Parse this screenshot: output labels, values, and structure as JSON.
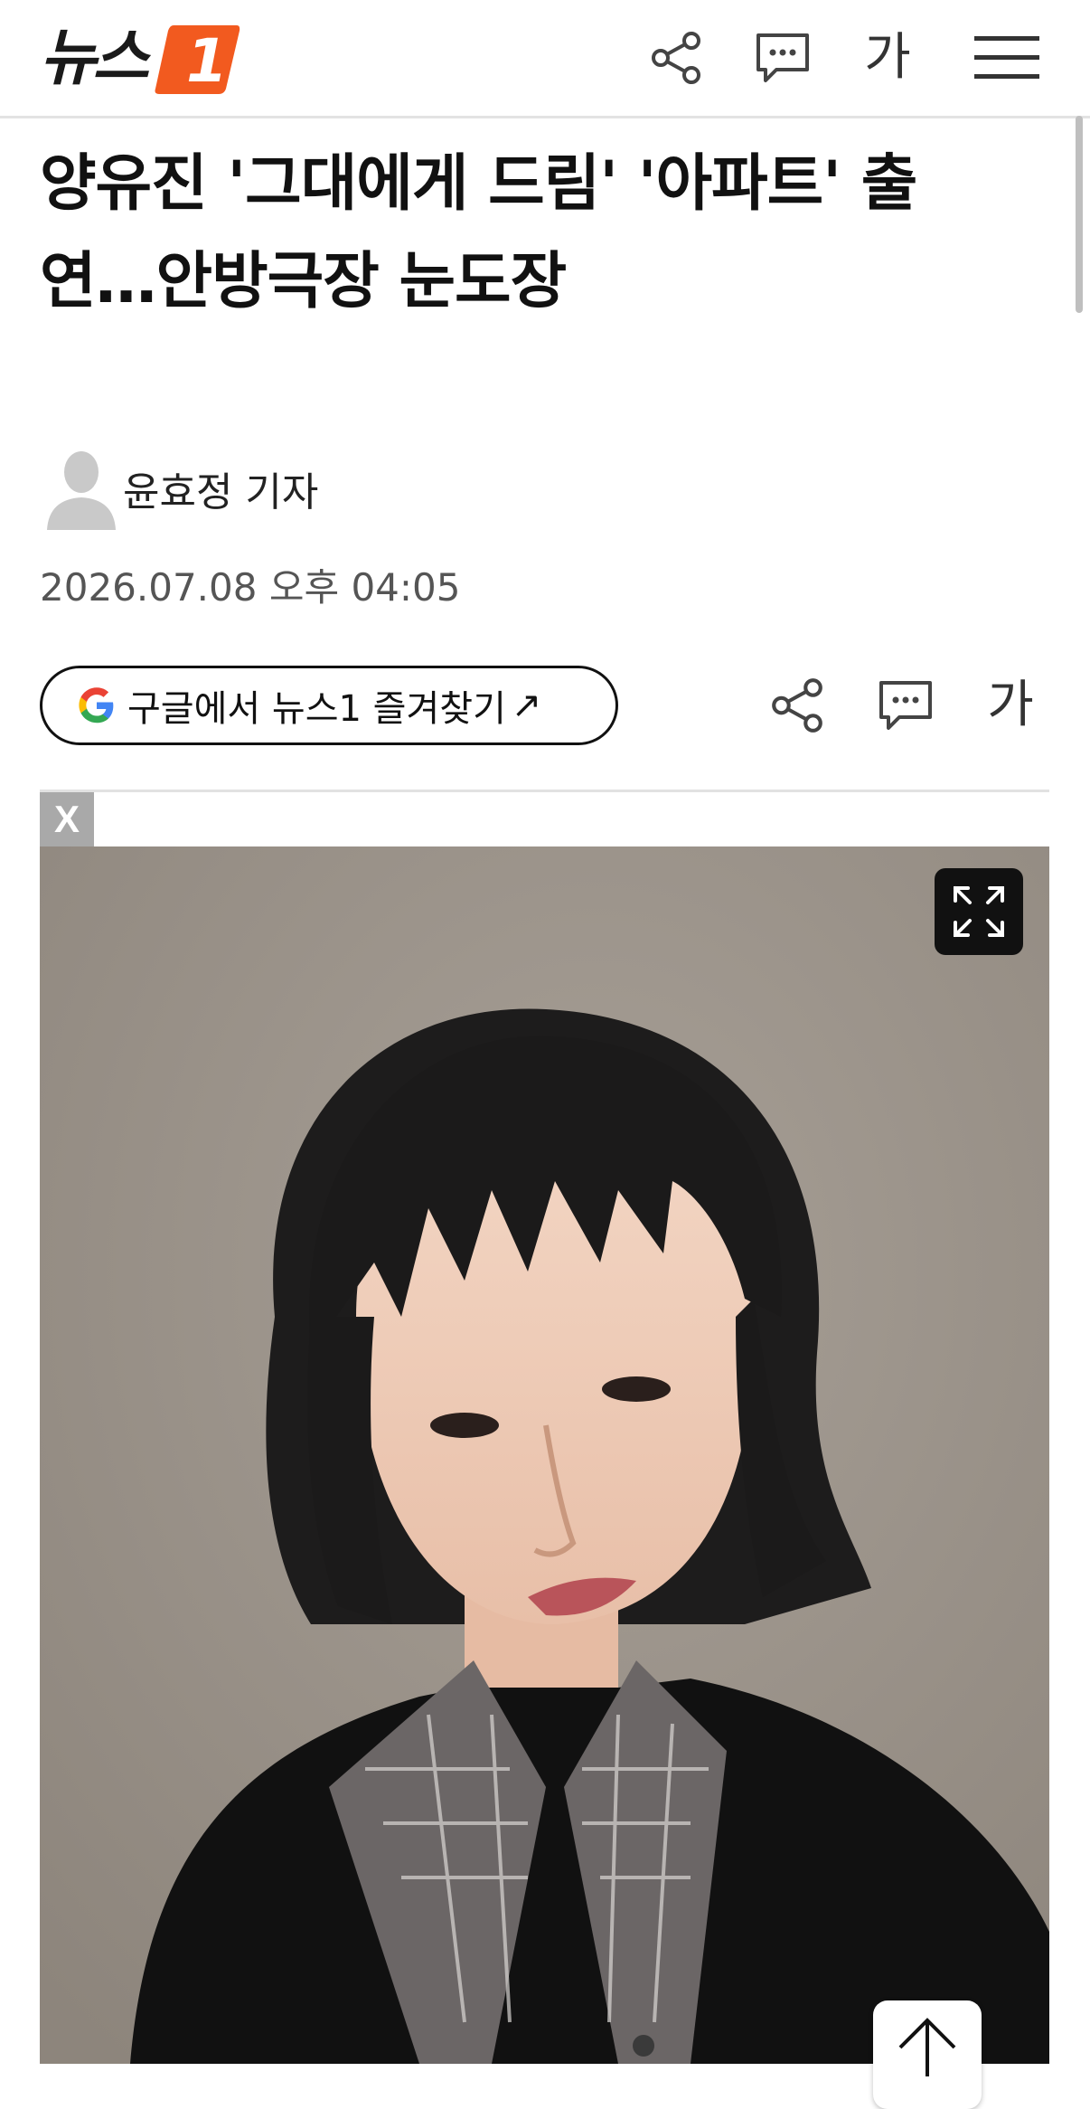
{
  "header": {
    "logo_text": "뉴스",
    "logo_badge_text": "1",
    "brand_color": "#f25a1f",
    "icons": [
      "share-icon",
      "comment-icon",
      "font-size-icon",
      "menu-icon"
    ],
    "font_size_label": "가"
  },
  "article": {
    "title_line1": "양유진 '그대에게 드림' '아파트' 출",
    "title_line2": "연…안방극장 눈도장",
    "author": "윤효정 기자",
    "date": "2026.07.08 오후 04:05",
    "google_button_label": "구글에서 뉴스1 즐겨찾기",
    "google_button_arrow": "↗",
    "font_size_label": "가"
  },
  "ad": {
    "close_label": "X"
  },
  "photo": {
    "description_icon": "expand-icon"
  }
}
